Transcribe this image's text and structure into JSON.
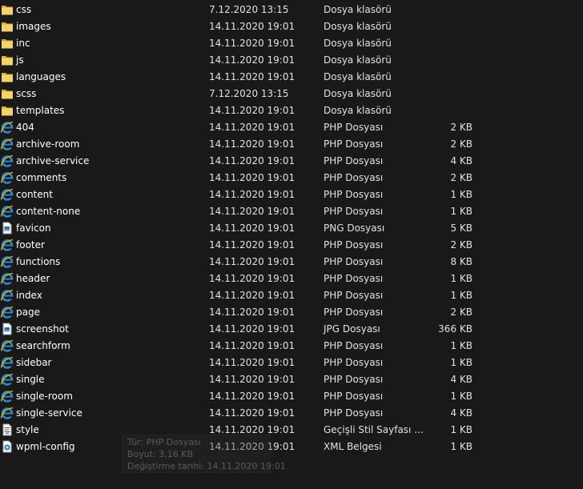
{
  "files": [
    {
      "name": "css",
      "date": "7.12.2020 13:15",
      "type": "Dosya klasörü",
      "size": "",
      "icon": "folder-icon"
    },
    {
      "name": "images",
      "date": "14.11.2020 19:01",
      "type": "Dosya klasörü",
      "size": "",
      "icon": "folder-icon"
    },
    {
      "name": "inc",
      "date": "14.11.2020 19:01",
      "type": "Dosya klasörü",
      "size": "",
      "icon": "folder-icon"
    },
    {
      "name": "js",
      "date": "14.11.2020 19:01",
      "type": "Dosya klasörü",
      "size": "",
      "icon": "folder-icon"
    },
    {
      "name": "languages",
      "date": "14.11.2020 19:01",
      "type": "Dosya klasörü",
      "size": "",
      "icon": "folder-icon"
    },
    {
      "name": "scss",
      "date": "7.12.2020 13:15",
      "type": "Dosya klasörü",
      "size": "",
      "icon": "folder-icon"
    },
    {
      "name": "templates",
      "date": "14.11.2020 19:01",
      "type": "Dosya klasörü",
      "size": "",
      "icon": "folder-icon"
    },
    {
      "name": "404",
      "date": "14.11.2020 19:01",
      "type": "PHP Dosyası",
      "size": "2 KB",
      "icon": "internet-explorer-icon"
    },
    {
      "name": "archive-room",
      "date": "14.11.2020 19:01",
      "type": "PHP Dosyası",
      "size": "2 KB",
      "icon": "internet-explorer-icon"
    },
    {
      "name": "archive-service",
      "date": "14.11.2020 19:01",
      "type": "PHP Dosyası",
      "size": "4 KB",
      "icon": "internet-explorer-icon"
    },
    {
      "name": "comments",
      "date": "14.11.2020 19:01",
      "type": "PHP Dosyası",
      "size": "2 KB",
      "icon": "internet-explorer-icon"
    },
    {
      "name": "content",
      "date": "14.11.2020 19:01",
      "type": "PHP Dosyası",
      "size": "1 KB",
      "icon": "internet-explorer-icon"
    },
    {
      "name": "content-none",
      "date": "14.11.2020 19:01",
      "type": "PHP Dosyası",
      "size": "1 KB",
      "icon": "internet-explorer-icon"
    },
    {
      "name": "favicon",
      "date": "14.11.2020 19:01",
      "type": "PNG Dosyası",
      "size": "5 KB",
      "icon": "image-file-icon"
    },
    {
      "name": "footer",
      "date": "14.11.2020 19:01",
      "type": "PHP Dosyası",
      "size": "2 KB",
      "icon": "internet-explorer-icon"
    },
    {
      "name": "functions",
      "date": "14.11.2020 19:01",
      "type": "PHP Dosyası",
      "size": "8 KB",
      "icon": "internet-explorer-icon"
    },
    {
      "name": "header",
      "date": "14.11.2020 19:01",
      "type": "PHP Dosyası",
      "size": "1 KB",
      "icon": "internet-explorer-icon"
    },
    {
      "name": "index",
      "date": "14.11.2020 19:01",
      "type": "PHP Dosyası",
      "size": "1 KB",
      "icon": "internet-explorer-icon"
    },
    {
      "name": "page",
      "date": "14.11.2020 19:01",
      "type": "PHP Dosyası",
      "size": "2 KB",
      "icon": "internet-explorer-icon"
    },
    {
      "name": "screenshot",
      "date": "14.11.2020 19:01",
      "type": "JPG Dosyası",
      "size": "366 KB",
      "icon": "image-file-icon"
    },
    {
      "name": "searchform",
      "date": "14.11.2020 19:01",
      "type": "PHP Dosyası",
      "size": "1 KB",
      "icon": "internet-explorer-icon"
    },
    {
      "name": "sidebar",
      "date": "14.11.2020 19:01",
      "type": "PHP Dosyası",
      "size": "1 KB",
      "icon": "internet-explorer-icon"
    },
    {
      "name": "single",
      "date": "14.11.2020 19:01",
      "type": "PHP Dosyası",
      "size": "4 KB",
      "icon": "internet-explorer-icon"
    },
    {
      "name": "single-room",
      "date": "14.11.2020 19:01",
      "type": "PHP Dosyası",
      "size": "1 KB",
      "icon": "internet-explorer-icon"
    },
    {
      "name": "single-service",
      "date": "14.11.2020 19:01",
      "type": "PHP Dosyası",
      "size": "4 KB",
      "icon": "internet-explorer-icon"
    },
    {
      "name": "style",
      "date": "14.11.2020 19:01",
      "type": "Geçişli Stil Sayfası ...",
      "size": "1 KB",
      "icon": "css-file-icon"
    },
    {
      "name": "wpml-config",
      "date": "14.11.2020 19:01",
      "type": "XML Belgesi",
      "size": "1 KB",
      "icon": "xml-file-icon"
    }
  ],
  "tooltip": {
    "line1": "Tür: PHP Dosyası",
    "line2": "Boyut: 3,16 KB",
    "line3": "Değiştirme tarihi: 14.11.2020 19:01"
  },
  "colors": {
    "background": "#191919",
    "text": "#ffffff",
    "folder": "#f5c542",
    "ie_blue": "#2a8ad4"
  }
}
